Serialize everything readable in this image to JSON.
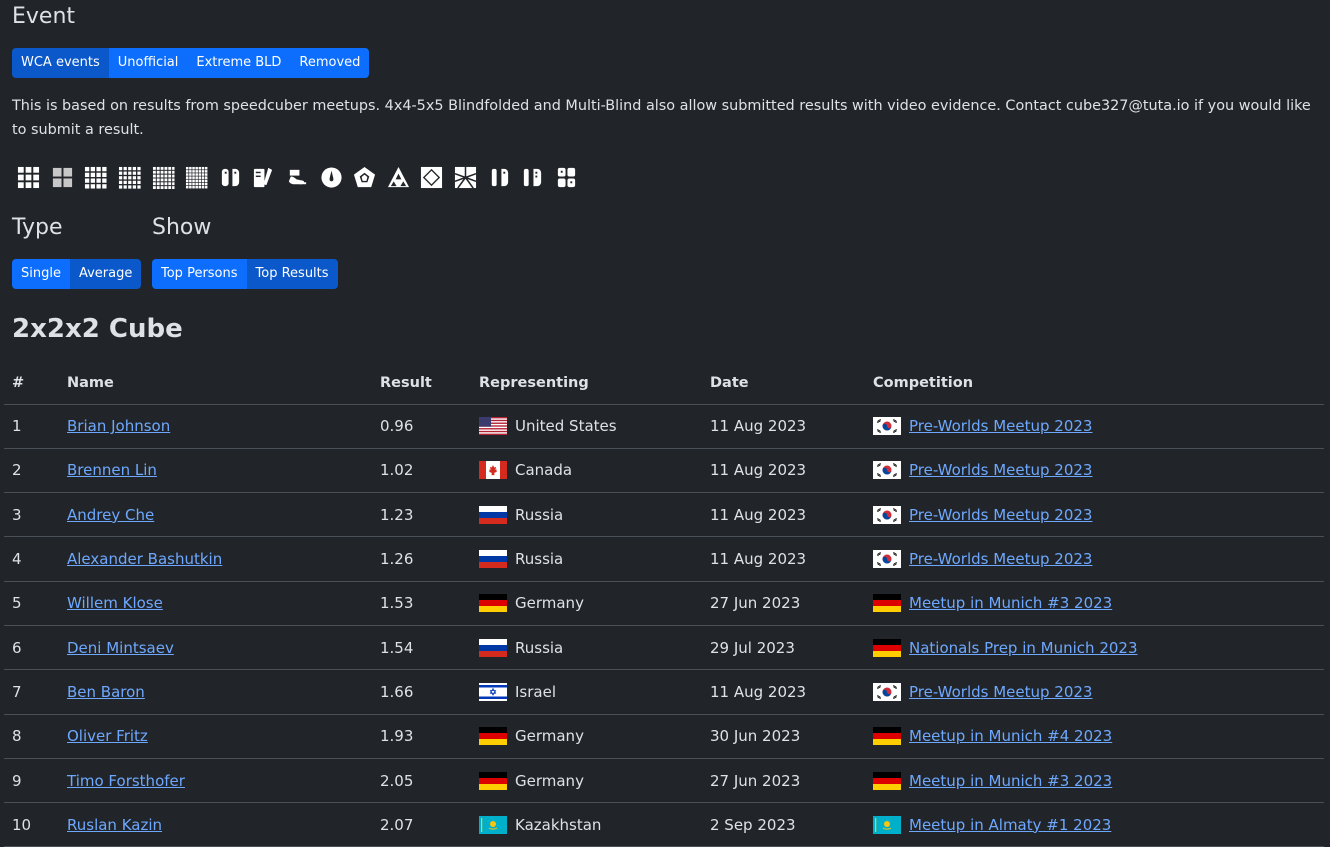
{
  "event_heading": "Event",
  "event_tabs": [
    {
      "label": "WCA events",
      "active": true
    },
    {
      "label": "Unofficial",
      "active": false
    },
    {
      "label": "Extreme BLD",
      "active": false
    },
    {
      "label": "Removed",
      "active": false
    }
  ],
  "description": "This is based on results from speedcuber meetups. 4x4-5x5 Blindfolded and Multi-Blind also allow submitted results with video evidence. Contact cube327@tuta.io if you would like to submit a result.",
  "event_icons": [
    "3x3-icon",
    "2x2-icon",
    "4x4-icon",
    "5x5-icon",
    "6x6-icon",
    "7x7-icon",
    "3bld-icon",
    "fmc-icon",
    "oh-icon",
    "clock-icon",
    "megaminx-icon",
    "pyraminx-icon",
    "skewb-icon",
    "square1-icon",
    "4bld-icon",
    "5bld-icon",
    "mbld-icon"
  ],
  "type_heading": "Type",
  "type_tabs": [
    {
      "label": "Single",
      "active": false
    },
    {
      "label": "Average",
      "active": true
    }
  ],
  "show_heading": "Show",
  "show_tabs": [
    {
      "label": "Top Persons",
      "active": false
    },
    {
      "label": "Top Results",
      "active": true
    }
  ],
  "table_title": "2x2x2 Cube",
  "columns": [
    "#",
    "Name",
    "Result",
    "Representing",
    "Date",
    "Competition"
  ],
  "rows": [
    {
      "rank": "1",
      "name": "Brian Johnson",
      "result": "0.96",
      "country": "United States",
      "country_flag": "us",
      "date": "11 Aug 2023",
      "comp_flag": "kr",
      "competition": "Pre-Worlds Meetup 2023"
    },
    {
      "rank": "2",
      "name": "Brennen Lin",
      "result": "1.02",
      "country": "Canada",
      "country_flag": "ca",
      "date": "11 Aug 2023",
      "comp_flag": "kr",
      "competition": "Pre-Worlds Meetup 2023"
    },
    {
      "rank": "3",
      "name": "Andrey Che",
      "result": "1.23",
      "country": "Russia",
      "country_flag": "ru",
      "date": "11 Aug 2023",
      "comp_flag": "kr",
      "competition": "Pre-Worlds Meetup 2023"
    },
    {
      "rank": "4",
      "name": "Alexander Bashutkin",
      "result": "1.26",
      "country": "Russia",
      "country_flag": "ru",
      "date": "11 Aug 2023",
      "comp_flag": "kr",
      "competition": "Pre-Worlds Meetup 2023"
    },
    {
      "rank": "5",
      "name": "Willem Klose",
      "result": "1.53",
      "country": "Germany",
      "country_flag": "de",
      "date": "27 Jun 2023",
      "comp_flag": "de",
      "competition": "Meetup in Munich #3 2023"
    },
    {
      "rank": "6",
      "name": "Deni Mintsaev",
      "result": "1.54",
      "country": "Russia",
      "country_flag": "ru",
      "date": "29 Jul 2023",
      "comp_flag": "de",
      "competition": "Nationals Prep in Munich 2023"
    },
    {
      "rank": "7",
      "name": "Ben Baron",
      "result": "1.66",
      "country": "Israel",
      "country_flag": "il",
      "date": "11 Aug 2023",
      "comp_flag": "kr",
      "competition": "Pre-Worlds Meetup 2023"
    },
    {
      "rank": "8",
      "name": "Oliver Fritz",
      "result": "1.93",
      "country": "Germany",
      "country_flag": "de",
      "date": "30 Jun 2023",
      "comp_flag": "de",
      "competition": "Meetup in Munich #4 2023"
    },
    {
      "rank": "9",
      "name": "Timo Forsthofer",
      "result": "2.05",
      "country": "Germany",
      "country_flag": "de",
      "date": "27 Jun 2023",
      "comp_flag": "de",
      "competition": "Meetup in Munich #3 2023"
    },
    {
      "rank": "10",
      "name": "Ruslan Kazin",
      "result": "2.07",
      "country": "Kazakhstan",
      "country_flag": "kz",
      "date": "2 Sep 2023",
      "comp_flag": "kz",
      "competition": "Meetup in Almaty #1 2023"
    }
  ],
  "colors": {
    "background": "#212529",
    "primary": "#0d6efd",
    "primary_active": "#0a58ca",
    "link": "#6ea8fe"
  }
}
